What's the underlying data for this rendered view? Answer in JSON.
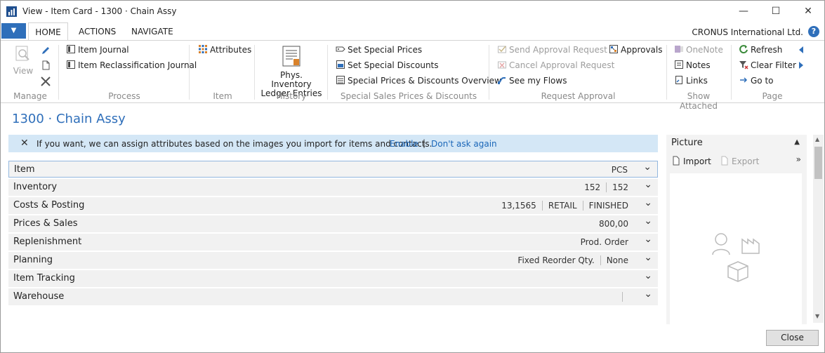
{
  "window": {
    "title": "View - Item Card - 1300 · Chain Assy"
  },
  "ribbon_tabs": {
    "home": "HOME",
    "actions": "ACTIONS",
    "navigate": "NAVIGATE"
  },
  "company": "CRONUS International Ltd.",
  "help_label": "?",
  "groups": {
    "manage": {
      "label": "Manage",
      "view": "View"
    },
    "process": {
      "label": "Process",
      "item_journal": "Item Journal",
      "item_reclass": "Item Reclassification Journal"
    },
    "item": {
      "label": "Item",
      "attributes": "Attributes"
    },
    "history": {
      "label": "History",
      "phys_inv_line1": "Phys. Inventory",
      "phys_inv_line2": "Ledger Entries"
    },
    "special": {
      "label": "Special Sales Prices & Discounts",
      "set_prices": "Set Special Prices",
      "set_discounts": "Set Special Discounts",
      "overview": "Special Prices & Discounts Overview"
    },
    "approval": {
      "label": "Request Approval",
      "send": "Send Approval Request",
      "cancel": "Cancel Approval Request",
      "flows": "See my Flows",
      "approvals": "Approvals"
    },
    "attached": {
      "label": "Show Attached",
      "onenote": "OneNote",
      "notes": "Notes",
      "links": "Links"
    },
    "page": {
      "label": "Page",
      "refresh": "Refresh",
      "clear_filter": "Clear Filter",
      "go_to": "Go to"
    }
  },
  "page_title": "1300 · Chain Assy",
  "notification": {
    "text": "If you want, we can assign attributes based on the images you import for items and contacts.",
    "enable": "Enable",
    "separator": "|",
    "dont_ask": "Don't ask again"
  },
  "fasttabs": [
    {
      "name": "Item",
      "values": [
        "PCS"
      ]
    },
    {
      "name": "Inventory",
      "values": [
        "152",
        "152"
      ]
    },
    {
      "name": "Costs & Posting",
      "values": [
        "13,1565",
        "RETAIL",
        "FINISHED"
      ]
    },
    {
      "name": "Prices & Sales",
      "values": [
        "800,00"
      ]
    },
    {
      "name": "Replenishment",
      "values": [
        "Prod. Order"
      ]
    },
    {
      "name": "Planning",
      "values": [
        "Fixed Reorder Qty.",
        "None"
      ]
    },
    {
      "name": "Item Tracking",
      "values": []
    },
    {
      "name": "Warehouse",
      "values": [
        ""
      ]
    }
  ],
  "picture": {
    "title": "Picture",
    "import": "Import",
    "export": "Export"
  },
  "close_button": "Close",
  "colors": {
    "accent": "#2f6fba",
    "notification_bg": "#d4e7f6"
  }
}
